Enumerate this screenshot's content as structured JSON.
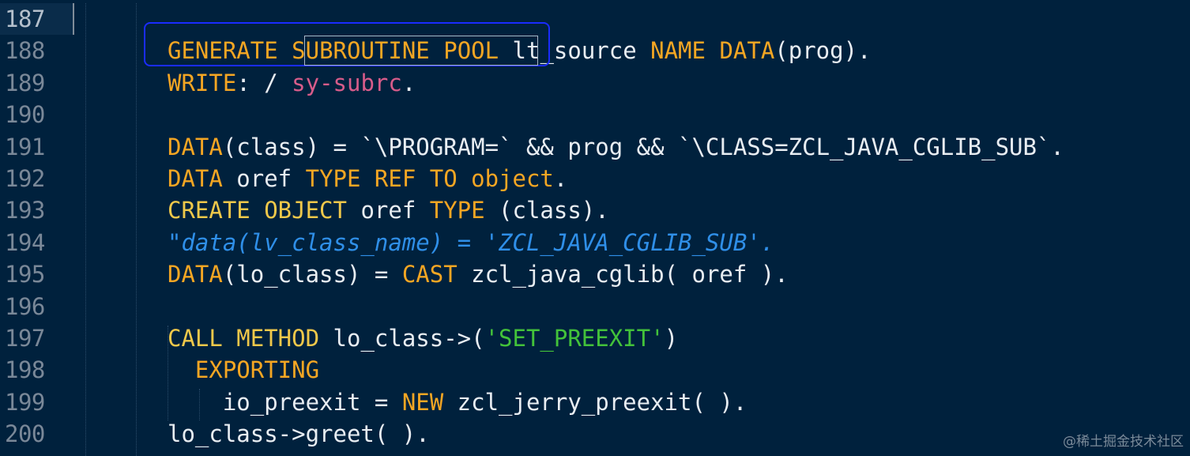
{
  "editor": {
    "cursor_line": 187,
    "lines": [
      {
        "num": "187",
        "tokens": []
      },
      {
        "num": "188",
        "tokens": [
          {
            "t": "GENERATE",
            "c": "kw"
          },
          {
            "t": " ",
            "c": "id"
          },
          {
            "t": "SUBROUTINE",
            "c": "kw"
          },
          {
            "t": " ",
            "c": "id"
          },
          {
            "t": "POOL",
            "c": "kw"
          },
          {
            "t": " lt_source ",
            "c": "id"
          },
          {
            "t": "NAME",
            "c": "kw"
          },
          {
            "t": " ",
            "c": "id"
          },
          {
            "t": "DATA",
            "c": "kw"
          },
          {
            "t": "(prog).",
            "c": "id"
          }
        ]
      },
      {
        "num": "189",
        "tokens": [
          {
            "t": "WRITE",
            "c": "kw"
          },
          {
            "t": ": / ",
            "c": "id"
          },
          {
            "t": "sy-subrc",
            "c": "pink"
          },
          {
            "t": ".",
            "c": "id"
          }
        ]
      },
      {
        "num": "190",
        "tokens": []
      },
      {
        "num": "191",
        "tokens": [
          {
            "t": "DATA",
            "c": "kw"
          },
          {
            "t": "(class) = `\\PROGRAM=` && prog && `\\CLASS=ZCL_JAVA_CGLIB_SUB`.",
            "c": "id"
          }
        ]
      },
      {
        "num": "192",
        "tokens": [
          {
            "t": "DATA",
            "c": "kw"
          },
          {
            "t": " oref ",
            "c": "id"
          },
          {
            "t": "TYPE REF TO object",
            "c": "kw"
          },
          {
            "t": ".",
            "c": "id"
          }
        ]
      },
      {
        "num": "193",
        "tokens": [
          {
            "t": "CREATE OBJECT",
            "c": "kw2"
          },
          {
            "t": " oref ",
            "c": "id"
          },
          {
            "t": "TYPE",
            "c": "kw"
          },
          {
            "t": " (class).",
            "c": "id"
          }
        ]
      },
      {
        "num": "194",
        "tokens": [
          {
            "t": "\"data(lv_class_name) = 'ZCL_JAVA_CGLIB_SUB'.",
            "c": "cmt"
          }
        ]
      },
      {
        "num": "195",
        "tokens": [
          {
            "t": "DATA",
            "c": "kw"
          },
          {
            "t": "(lo_class) = ",
            "c": "id"
          },
          {
            "t": "CAST",
            "c": "kw"
          },
          {
            "t": " zcl_java_cglib( oref ).",
            "c": "id"
          }
        ]
      },
      {
        "num": "196",
        "tokens": []
      },
      {
        "num": "197",
        "tokens": [
          {
            "t": "CALL METHOD",
            "c": "kw2"
          },
          {
            "t": " lo_class->(",
            "c": "id"
          },
          {
            "t": "'SET_PREEXIT'",
            "c": "str"
          },
          {
            "t": ")",
            "c": "id"
          }
        ]
      },
      {
        "num": "198",
        "tokens": [
          {
            "t": "  ",
            "c": "id"
          },
          {
            "t": "EXPORTING",
            "c": "kw"
          }
        ]
      },
      {
        "num": "199",
        "tokens": [
          {
            "t": "    io_preexit = ",
            "c": "id"
          },
          {
            "t": "NEW",
            "c": "kw"
          },
          {
            "t": " zcl_jerry_preexit( ).",
            "c": "id"
          }
        ]
      },
      {
        "num": "200",
        "tokens": [
          {
            "t": "lo_class->greet( ).",
            "c": "id"
          }
        ]
      }
    ]
  },
  "colors": {
    "background": "#00213d",
    "keyword": "#f5a623",
    "string": "#43c23a",
    "comment": "#2f8fe8",
    "system_field": "#d85c8a",
    "highlight_box": "#1a2cff"
  },
  "watermark": "@稀土掘金技术社区"
}
